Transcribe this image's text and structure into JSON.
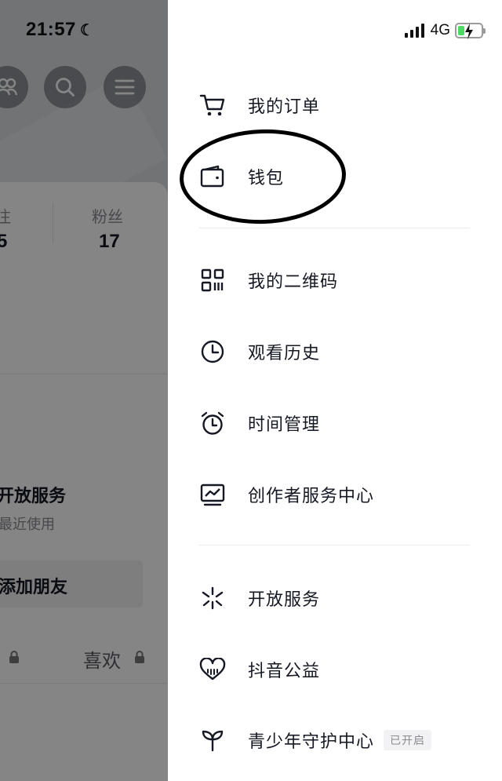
{
  "status_bar": {
    "time": "21:57",
    "network": "4G",
    "colors": {
      "battery_fill": "#4cd964"
    }
  },
  "background": {
    "stats": [
      {
        "label": "注",
        "value": "5"
      },
      {
        "label": "粉丝",
        "value": "17"
      }
    ],
    "service_title": "开放服务",
    "service_subtitle": "最近使用",
    "add_friend_label": "添加朋友",
    "tab_like": "喜欢"
  },
  "drawer": {
    "groups": [
      [
        {
          "id": "orders",
          "label": "我的订单",
          "icon": "cart-icon"
        },
        {
          "id": "wallet",
          "label": "钱包",
          "icon": "wallet-icon"
        }
      ],
      [
        {
          "id": "qrcode",
          "label": "我的二维码",
          "icon": "qr-code-icon"
        },
        {
          "id": "history",
          "label": "观看历史",
          "icon": "clock-icon"
        },
        {
          "id": "time-mgmt",
          "label": "时间管理",
          "icon": "alarm-clock-icon"
        },
        {
          "id": "creator",
          "label": "创作者服务中心",
          "icon": "chart-monitor-icon"
        }
      ],
      [
        {
          "id": "open-services",
          "label": "开放服务",
          "icon": "sparkle-icon"
        },
        {
          "id": "charity",
          "label": "抖音公益",
          "icon": "heart-icon"
        },
        {
          "id": "youth",
          "label": "青少年守护中心",
          "icon": "sprout-icon",
          "badge": "已开启"
        }
      ]
    ]
  }
}
